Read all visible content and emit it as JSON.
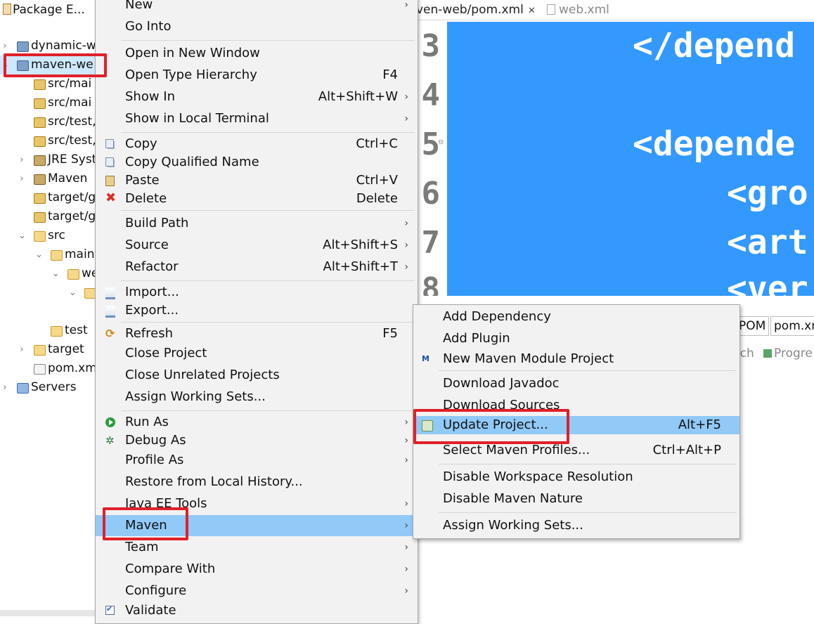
{
  "explorer": {
    "title": "Package E...",
    "items": [
      {
        "label": "dynamic-w",
        "icon": "project-icon"
      },
      {
        "label": "maven-we",
        "icon": "maven-project-icon",
        "selected": true
      },
      {
        "label": "src/mai",
        "icon": "source-folder-icon"
      },
      {
        "label": "src/mai",
        "icon": "source-folder-icon"
      },
      {
        "label": "src/test,",
        "icon": "source-folder-icon"
      },
      {
        "label": "src/test,",
        "icon": "source-folder-icon"
      },
      {
        "label": "JRE Syst",
        "icon": "library-icon"
      },
      {
        "label": "Maven",
        "icon": "library-icon"
      },
      {
        "label": "target/g",
        "icon": "source-folder-icon"
      },
      {
        "label": "target/g",
        "icon": "source-folder-icon"
      },
      {
        "label": "src",
        "icon": "folder-icon"
      },
      {
        "label": "main",
        "icon": "folder-icon"
      },
      {
        "label": "we",
        "icon": "folder-icon"
      },
      {
        "label": "",
        "icon": "folder-icon"
      },
      {
        "label": "test",
        "icon": "folder-icon"
      },
      {
        "label": "target",
        "icon": "folder-icon"
      },
      {
        "label": "pom.xm",
        "icon": "xml-file-icon"
      },
      {
        "label": "Servers",
        "icon": "servers-folder-icon"
      }
    ]
  },
  "editor": {
    "tabs": [
      {
        "label": "ven-web/pom.xml",
        "active": true
      },
      {
        "label": "web.xml",
        "active": false
      }
    ],
    "line_numbers": [
      "3",
      "4",
      "5",
      "6",
      "7",
      "8"
    ],
    "code_lines": [
      "</depend",
      "<depende",
      "<gro",
      "<art",
      "<ver"
    ],
    "bottom_tabs": [
      "POM",
      "pom.xm"
    ],
    "view_tabs": [
      "rch",
      "Progre"
    ]
  },
  "context_menu": {
    "items": [
      {
        "label": "New",
        "submenu": true
      },
      {
        "label": "Go Into"
      },
      {
        "label": "Open in New Window"
      },
      {
        "label": "Open Type Hierarchy",
        "shortcut": "F4"
      },
      {
        "label": "Show In",
        "shortcut": "Alt+Shift+W",
        "submenu": true
      },
      {
        "label": "Show in Local Terminal",
        "submenu": true
      },
      {
        "label": "Copy",
        "shortcut": "Ctrl+C"
      },
      {
        "label": "Copy Qualified Name"
      },
      {
        "label": "Paste",
        "shortcut": "Ctrl+V"
      },
      {
        "label": "Delete",
        "shortcut": "Delete"
      },
      {
        "label": "Build Path",
        "submenu": true
      },
      {
        "label": "Source",
        "shortcut": "Alt+Shift+S",
        "submenu": true
      },
      {
        "label": "Refactor",
        "shortcut": "Alt+Shift+T",
        "submenu": true
      },
      {
        "label": "Import..."
      },
      {
        "label": "Export..."
      },
      {
        "label": "Refresh",
        "shortcut": "F5"
      },
      {
        "label": "Close Project"
      },
      {
        "label": "Close Unrelated Projects"
      },
      {
        "label": "Assign Working Sets..."
      },
      {
        "label": "Run As",
        "submenu": true
      },
      {
        "label": "Debug As",
        "submenu": true
      },
      {
        "label": "Profile As",
        "submenu": true
      },
      {
        "label": "Restore from Local History..."
      },
      {
        "label": "Java EE Tools",
        "submenu": true
      },
      {
        "label": "Maven",
        "submenu": true,
        "highlighted": true
      },
      {
        "label": "Team",
        "submenu": true
      },
      {
        "label": "Compare With",
        "submenu": true
      },
      {
        "label": "Configure",
        "submenu": true
      },
      {
        "label": "Validate"
      }
    ]
  },
  "maven_submenu": {
    "items": [
      {
        "label": "Add Dependency"
      },
      {
        "label": "Add Plugin"
      },
      {
        "label": "New Maven Module Project"
      },
      {
        "label": "Download Javadoc"
      },
      {
        "label": "Download Sources"
      },
      {
        "label": "Update Project...",
        "shortcut": "Alt+F5",
        "highlighted": true
      },
      {
        "label": "Select Maven Profiles...",
        "shortcut": "Ctrl+Alt+P"
      },
      {
        "label": "Disable Workspace Resolution"
      },
      {
        "label": "Disable Maven Nature"
      },
      {
        "label": "Assign Working Sets..."
      }
    ]
  },
  "glyphs": {
    "submenu_arrow": "›",
    "expanded_arrow": "⌄",
    "collapsed_arrow": "›",
    "close_x": "✕",
    "delete_x": "✖",
    "refresh": "⟳",
    "debug": "✲",
    "fold": "⊖",
    "mvn_badge": "M"
  },
  "colors": {
    "selection": "#3399ff",
    "menu_highlight": "#91c9f7",
    "annotation": "#e0202a"
  }
}
